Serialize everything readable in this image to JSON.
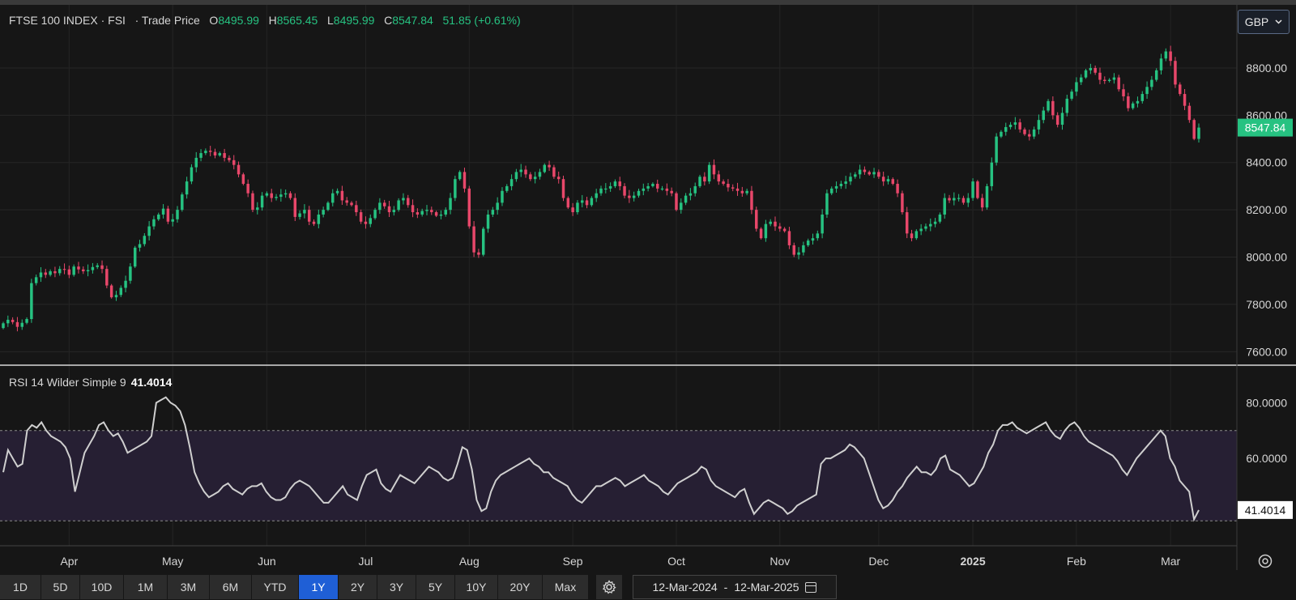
{
  "header": {
    "symbol": "FTSE 100 INDEX · FSI",
    "price_type": "· Trade Price",
    "open_label": "O",
    "open": "8495.99",
    "high_label": "H",
    "high": "8565.45",
    "low_label": "L",
    "low": "8495.99",
    "close_label": "C",
    "close": "8547.84",
    "change": "51.85 (+0.61%)"
  },
  "currency": {
    "selected": "GBP"
  },
  "rsi": {
    "label": "RSI 14 Wilder Simple 9",
    "value": "41.4014"
  },
  "ranges": [
    "1D",
    "5D",
    "10D",
    "1M",
    "3M",
    "6M",
    "YTD",
    "1Y",
    "2Y",
    "3Y",
    "5Y",
    "10Y",
    "20Y",
    "Max"
  ],
  "active_range": "1Y",
  "date_range": {
    "from": "12-Mar-2024",
    "sep": "-",
    "to": "12-Mar-2025"
  },
  "colors": {
    "up": "#26c281",
    "down": "#e8476a",
    "rsi_line": "#cfcfcf",
    "rsi_band": "#261f33",
    "active": "#1f5fd6"
  },
  "chart_data": [
    {
      "type": "candlestick",
      "title": "FTSE 100 INDEX · FSI",
      "x_tick_labels": [
        "Apr",
        "May",
        "Jun",
        "Jul",
        "Aug",
        "Sep",
        "Oct",
        "Nov",
        "Dec",
        "2025",
        "Feb",
        "Mar"
      ],
      "y_tick_labels": [
        "7600.00",
        "7800.00",
        "8000.00",
        "8200.00",
        "8400.00",
        "8600.00",
        "8800.00"
      ],
      "ylim": [
        7560,
        8930
      ],
      "last_price_label": "8547.84",
      "grid": true,
      "close": [
        7720,
        7735,
        7725,
        7705,
        7722,
        7738,
        7890,
        7915,
        7935,
        7925,
        7940,
        7932,
        7950,
        7948,
        7925,
        7960,
        7948,
        7940,
        7945,
        7958,
        7965,
        7950,
        7880,
        7830,
        7840,
        7870,
        7900,
        7960,
        8040,
        8055,
        8090,
        8130,
        8160,
        8180,
        8205,
        8150,
        8160,
        8200,
        8265,
        8320,
        8380,
        8420,
        8440,
        8450,
        8445,
        8430,
        8440,
        8420,
        8410,
        8390,
        8350,
        8310,
        8270,
        8200,
        8210,
        8260,
        8270,
        8250,
        8255,
        8265,
        8270,
        8250,
        8170,
        8185,
        8200,
        8150,
        8140,
        8180,
        8200,
        8230,
        8270,
        8280,
        8240,
        8230,
        8220,
        8190,
        8150,
        8140,
        8165,
        8200,
        8230,
        8215,
        8190,
        8200,
        8240,
        8250,
        8220,
        8190,
        8180,
        8195,
        8200,
        8190,
        8175,
        8180,
        8200,
        8250,
        8330,
        8360,
        8290,
        8130,
        8020,
        8010,
        8120,
        8180,
        8200,
        8230,
        8280,
        8300,
        8330,
        8360,
        8370,
        8350,
        8330,
        8340,
        8360,
        8390,
        8380,
        8340,
        8330,
        8250,
        8210,
        8190,
        8230,
        8240,
        8220,
        8250,
        8270,
        8290,
        8290,
        8300,
        8320,
        8300,
        8260,
        8250,
        8260,
        8280,
        8290,
        8300,
        8310,
        8290,
        8290,
        8280,
        8270,
        8200,
        8230,
        8260,
        8270,
        8300,
        8340,
        8320,
        8390,
        8350,
        8320,
        8310,
        8295,
        8290,
        8280,
        8270,
        8280,
        8200,
        8120,
        8080,
        8140,
        8150,
        8130,
        8120,
        8110,
        8050,
        8010,
        8020,
        8050,
        8070,
        8080,
        8100,
        8180,
        8270,
        8290,
        8300,
        8310,
        8320,
        8340,
        8350,
        8370,
        8360,
        8350,
        8360,
        8340,
        8320,
        8330,
        8310,
        8270,
        8190,
        8100,
        8080,
        8110,
        8120,
        8130,
        8140,
        8150,
        8180,
        8250,
        8240,
        8250,
        8250,
        8230,
        8250,
        8320,
        8250,
        8210,
        8300,
        8400,
        8510,
        8530,
        8550,
        8560,
        8570,
        8540,
        8520,
        8510,
        8540,
        8580,
        8620,
        8660,
        8600,
        8560,
        8610,
        8670,
        8700,
        8740,
        8760,
        8790,
        8800,
        8780,
        8750,
        8745,
        8750,
        8760,
        8710,
        8680,
        8630,
        8650,
        8660,
        8690,
        8720,
        8750,
        8790,
        8840,
        8870,
        8830,
        8730,
        8690,
        8640,
        8580,
        8500,
        8547.84
      ]
    },
    {
      "type": "line",
      "title": "RSI 14 Wilder Simple 9",
      "y_tick_labels": [
        "60.0000",
        "80.0000"
      ],
      "ylim": [
        29.7,
        88
      ],
      "band": [
        37.5,
        70
      ],
      "last_value_label": "41.4014",
      "values": [
        55,
        63,
        60,
        57,
        58,
        70,
        72,
        71,
        73,
        70,
        68,
        67,
        66,
        64,
        60,
        48,
        55,
        62,
        65,
        68,
        72,
        73,
        70,
        68,
        69,
        66,
        62,
        63,
        64,
        65,
        66,
        68,
        80,
        81,
        82,
        80,
        79,
        77,
        72,
        64,
        55,
        51,
        48,
        46,
        47,
        48,
        50,
        51,
        49,
        48,
        47,
        49,
        50,
        50,
        51,
        48,
        46,
        45,
        45,
        46,
        49,
        51,
        52,
        51,
        50,
        48,
        46,
        44,
        44,
        46,
        48,
        50,
        47,
        46,
        45,
        50,
        54,
        55,
        56,
        51,
        49,
        48,
        51,
        54,
        53,
        52,
        51,
        53,
        55,
        57,
        56,
        55,
        53,
        52,
        53,
        58,
        64,
        63,
        56,
        45,
        41,
        42,
        48,
        52,
        54,
        55,
        56,
        57,
        58,
        59,
        60,
        58,
        57,
        55,
        55,
        53,
        52,
        51,
        50,
        47,
        45,
        44,
        46,
        48,
        50,
        50,
        51,
        52,
        53,
        52,
        50,
        51,
        52,
        53,
        54,
        52,
        51,
        50,
        48,
        47,
        49,
        51,
        52,
        53,
        54,
        55,
        57,
        56,
        52,
        50,
        49,
        48,
        47,
        46,
        48,
        49,
        44,
        40,
        42,
        44,
        45,
        44,
        43,
        42,
        40,
        41,
        43,
        44,
        45,
        46,
        47,
        58,
        60,
        60,
        61,
        62,
        63,
        65,
        64,
        62,
        60,
        55,
        50,
        45,
        42,
        43,
        45,
        48,
        50,
        53,
        55,
        57,
        55,
        55,
        54,
        56,
        60,
        61,
        56,
        55,
        54,
        52,
        50,
        51,
        54,
        57,
        62,
        65,
        70,
        72,
        72,
        73,
        71,
        70,
        69,
        70,
        71,
        72,
        73,
        70,
        68,
        67,
        70,
        72,
        73,
        71,
        68,
        66,
        65,
        64,
        63,
        62,
        61,
        59,
        56,
        54,
        57,
        60,
        62,
        64,
        66,
        68,
        70,
        68,
        60,
        57,
        52,
        50,
        48,
        38,
        41.4014
      ]
    }
  ]
}
